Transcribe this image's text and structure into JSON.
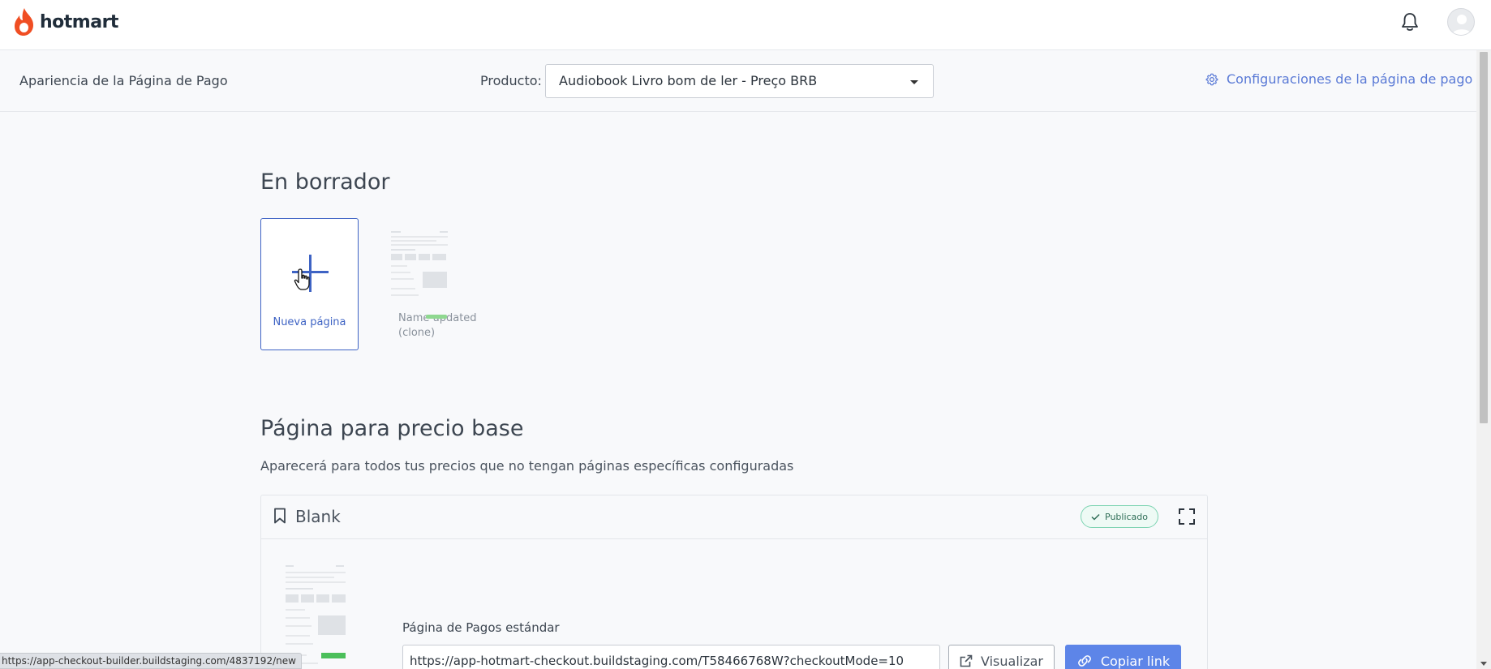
{
  "brand": {
    "name": "hotmart",
    "color": "#f04e23"
  },
  "header": {
    "notifications_icon": "bell-icon",
    "avatar_icon": "user-avatar"
  },
  "subheader": {
    "title": "Apariencia de la Página de Pago",
    "product_label": "Producto:",
    "product_value": "Audiobook Livro bom de ler - Preço BRB",
    "config_link": "Configuraciones de la página de pago"
  },
  "drafts": {
    "title": "En borrador",
    "new_page_label": "Nueva página",
    "items": [
      {
        "name_line1": "Name updated",
        "name_line2": "(clone)"
      }
    ]
  },
  "base_price": {
    "title": "Página para precio base",
    "subtitle": "Aparecerá para todos tus precios que no tengan páginas específicas configuradas",
    "card": {
      "name": "Blank",
      "status": "Publicado",
      "status_color": "#7fd4b3",
      "standard_label": "Página de Pagos estándar",
      "url": "https://app-hotmart-checkout.buildstaging.com/T58466768W?checkoutMode=10",
      "view_button": "Visualizar",
      "copy_button": "Copiar link"
    }
  },
  "status_bar": {
    "url": "https://app-checkout-builder.buildstaging.com/4837192/new"
  },
  "colors": {
    "accent": "#3e63c4",
    "link": "#5a7ad6",
    "primary_button": "#5d85e8"
  }
}
